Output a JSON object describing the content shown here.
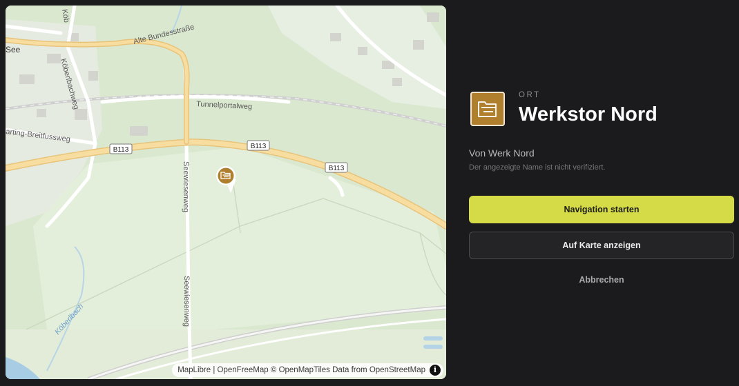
{
  "map": {
    "labels": {
      "road_alte_bundesstrasse": "Alte Bundesstraße",
      "road_tunnelportalweg": "Tunnelportalweg",
      "road_seewiesenweg": "Seewiesenweg",
      "road_koeberlbachweg": "Köberlbachweg",
      "road_breitfussweg": "arting-Breitfussweg",
      "road_koeb_top": "Köb",
      "place_see": "See",
      "water_koeberlbach": "Köberlbach",
      "shield_b113": "B113"
    },
    "attribution": {
      "maplibre": "MapLibre",
      "sep": " | ",
      "openfreemap": "OpenFreeMap",
      "copyright": " © ",
      "openmaptiles": "OpenMapTiles",
      "data_from": " Data from ",
      "osm": "OpenStreetMap"
    },
    "info_glyph": "i",
    "marker_icon": "folder-open-icon"
  },
  "panel": {
    "kicker": "ORT",
    "title": "Werkstor Nord",
    "from": "Von Werk Nord",
    "disclaimer": "Der angezeigte Name ist nicht verifiziert.",
    "primary_button": "Navigation starten",
    "secondary_button": "Auf Karte anzeigen",
    "cancel_button": "Abbrechen",
    "icon": "folder-open-icon"
  },
  "colors": {
    "accent": "#d5db47",
    "place_icon_bg": "#b07f2e",
    "background": "#1b1b1d"
  }
}
